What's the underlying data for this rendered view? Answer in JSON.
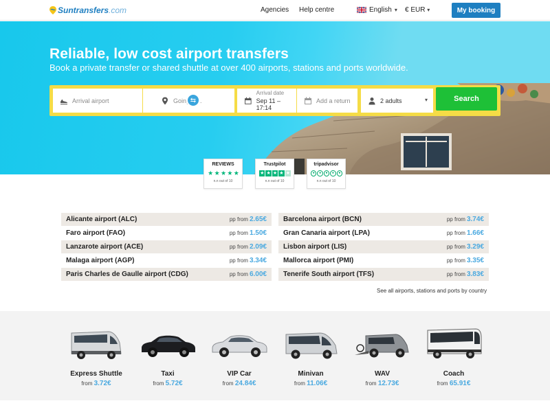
{
  "header": {
    "logo_brand": "Suntransfers",
    "logo_tld": ".com",
    "nav": [
      "Agencies",
      "Help centre"
    ],
    "language": "English",
    "currency": "€ EUR",
    "my_booking": "My booking"
  },
  "hero": {
    "title": "Reliable, low cost airport transfers",
    "subtitle": "Book a private transfer or shared shuttle at over 400 airports, stations and ports worldwide."
  },
  "search": {
    "from_placeholder": "Arrival airport",
    "to_placeholder": "Going to...",
    "date_label": "Arrival date",
    "date_value": "Sep 11 – 17:14",
    "return_placeholder": "Add a return",
    "passengers": "2 adults",
    "button": "Search"
  },
  "reviews": [
    {
      "name": "REVIEWS",
      "score": "n.n out of 10",
      "style": "box"
    },
    {
      "name": "Trustpilot",
      "score": "n.n out of 10",
      "style": "box"
    },
    {
      "name": "tripadvisor",
      "score": "n.n out of 10",
      "style": "round"
    }
  ],
  "airports": {
    "pp_from": "pp from",
    "left": [
      {
        "name": "Alicante airport (ALC)",
        "price": "2.65€"
      },
      {
        "name": "Faro airport (FAO)",
        "price": "1.50€"
      },
      {
        "name": "Lanzarote airport (ACE)",
        "price": "2.09€"
      },
      {
        "name": "Malaga airport (AGP)",
        "price": "3.34€"
      },
      {
        "name": "Paris Charles de Gaulle airport (CDG)",
        "price": "6.00€"
      }
    ],
    "right": [
      {
        "name": "Barcelona airport (BCN)",
        "price": "3.74€"
      },
      {
        "name": "Gran Canaria airport (LPA)",
        "price": "1.66€"
      },
      {
        "name": "Lisbon airport (LIS)",
        "price": "3.29€"
      },
      {
        "name": "Mallorca airport (PMI)",
        "price": "3.35€"
      },
      {
        "name": "Tenerife South airport (TFS)",
        "price": "3.83€"
      }
    ],
    "see_all": "See all airports, stations and ports by country"
  },
  "vehicles": {
    "from_label": "from",
    "items": [
      {
        "name": "Express Shuttle",
        "price": "3.72€",
        "icon": "minibus-icon"
      },
      {
        "name": "Taxi",
        "price": "5.72€",
        "icon": "taxi-car-icon"
      },
      {
        "name": "VIP Car",
        "price": "24.84€",
        "icon": "vip-car-icon"
      },
      {
        "name": "Minivan",
        "price": "11.06€",
        "icon": "minivan-icon"
      },
      {
        "name": "WAV",
        "price": "12.73€",
        "icon": "wheelchair-van-icon"
      },
      {
        "name": "Coach",
        "price": "65.91€",
        "icon": "coach-icon"
      }
    ]
  },
  "colors": {
    "brand": "#1e7fc1",
    "search_bar": "#f5dc46",
    "search_button": "#1ec037",
    "price": "#4aa9e0",
    "hero": "#18c8ec"
  }
}
